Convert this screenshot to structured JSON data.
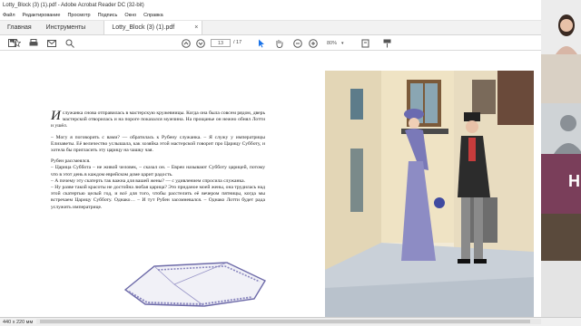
{
  "window": {
    "title": "Lotty_Block (3) (1).pdf - Adobe Acrobat Reader DC (32-bit)"
  },
  "menu": [
    "Файл",
    "Редактирование",
    "Просмотр",
    "Подпись",
    "Окно",
    "Справка"
  ],
  "tabs": {
    "home": "Главная",
    "tools": "Инструменты",
    "document": "Lotty_Block (3) (1).pdf",
    "close": "×"
  },
  "toolbar": {
    "page_current": "13",
    "page_total": "/ 17",
    "zoom": "80%"
  },
  "document": {
    "p1_dropcap": "И",
    "p1": "служанка снова отправилась в мастерскую кружевницы. Когда она была совсем рядом, дверь мастерской отворилась и на пороге показался мужчина. На прощанье он нежно обнял Лотти и ушёл.",
    "p2": "– Могу я поговорить с вами? — обратилась к Рубену служанка. – Я служу у императрицы Елизаветы. Её величество услышала, как хозяйка этой мастерской говорит про Царицу Субботу, и хотела бы пригласить эту царицу на чашку чая.",
    "p3": "Рубен рассмеялся.",
    "p4": "– Царица Суббота – не живой человек, – сказал он. – Евреи называют Субботу царицей, потому что в этот день в каждом еврейском доме царит радость.",
    "p5": "– А почему эту скатерть так важна для вашей жены? — с удивлением спросила служанка.",
    "p6": "– Ну разве такой красоты не достойна любая царица? Это приданое моей жены, она трудилась над этой скатертью целый год, и всё для того, чтобы расстелить её вечером пятницы, когда мы встречаем Царицу Субботу. Однако… – И тут Рубен засомневался. – Однако Лотти будет рада услужить императрице."
  },
  "status": {
    "page_size": "440 x 220 мм"
  },
  "video": {
    "tile_letter": "H"
  },
  "colors": {
    "accent": "#1a73e8",
    "tile": "#7a3e5a"
  }
}
